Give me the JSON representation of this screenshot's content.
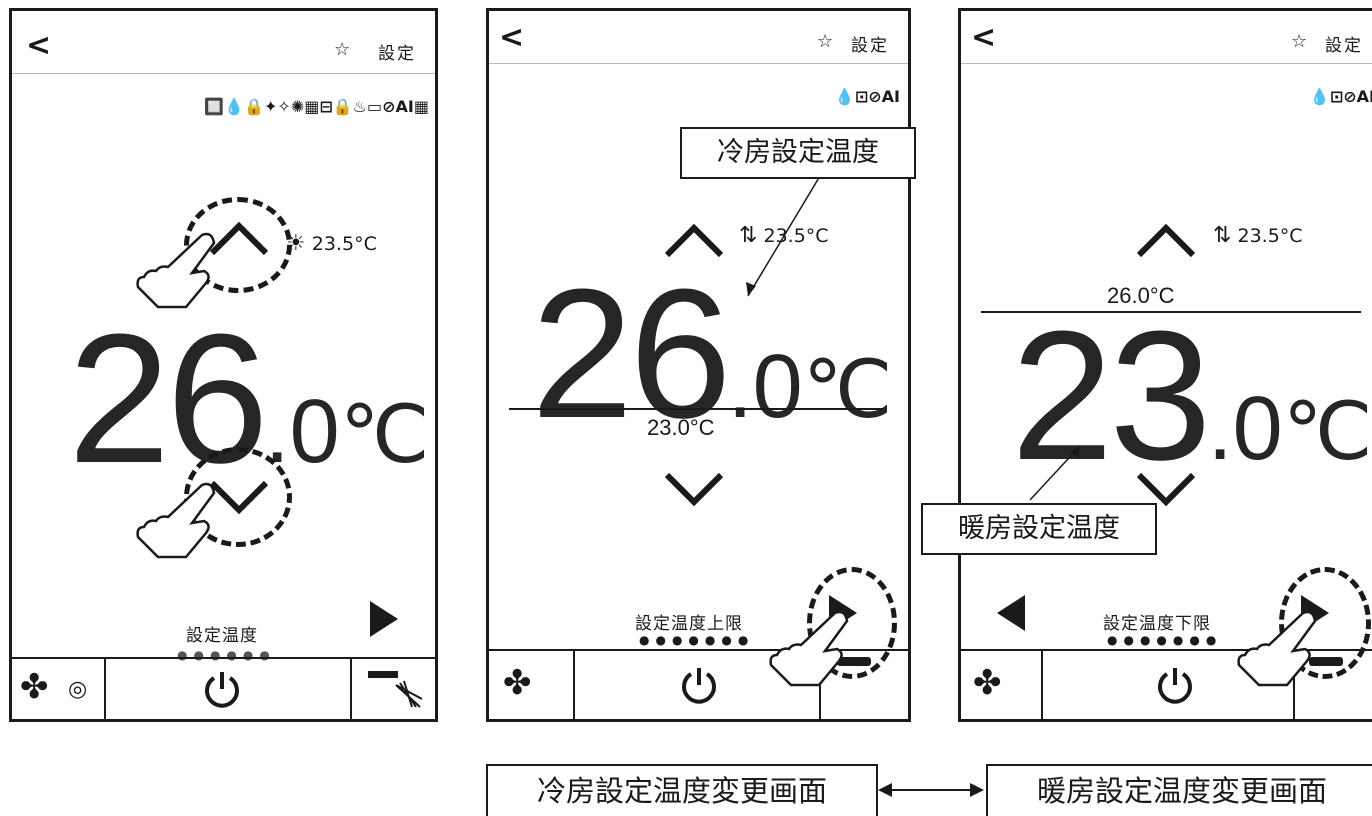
{
  "screens": [
    {
      "back_glyph": "<",
      "star_glyph": "☆",
      "settings_label": "設定",
      "status_icons": "🔲💧🔒✦✧✺▦⊟🔒♨▭⊘AI▦",
      "temp_integer": "26",
      "temp_decimal": ".0",
      "temp_unit": "℃",
      "ambient_icon": "sun-icon",
      "ambient_temp": "23.5°C",
      "page_label": "設定温度",
      "page_dots": "●●●●●●",
      "page_index": 1
    },
    {
      "back_glyph": "<",
      "star_glyph": "☆",
      "settings_label": "設定",
      "status_icons": "AI",
      "temp_integer": "26",
      "temp_decimal": ".0",
      "temp_unit": "℃",
      "ambient_icon": "swap-arrows-icon",
      "ambient_temp": "23.5°C",
      "secondary_temp": "23.0°C",
      "page_label": "設定温度上限",
      "page_dots": "●●●●●●●",
      "page_index": 1
    },
    {
      "back_glyph": "<",
      "star_glyph": "☆",
      "settings_label": "設定",
      "status_icons": "AI",
      "temp_integer": "23",
      "temp_decimal": ".0",
      "temp_unit": "℃",
      "ambient_icon": "swap-arrows-icon",
      "ambient_temp": "23.5°C",
      "secondary_temp": "26.0°C",
      "page_label": "設定温度下限",
      "page_dots": "●●●●●●●",
      "page_index": 2
    }
  ],
  "callouts": {
    "cooling_setpoint": "冷房設定温度",
    "heating_setpoint": "暖房設定温度"
  },
  "captions": {
    "cooling_screen": "冷房設定温度変更画面",
    "heating_screen": "暖房設定温度変更画面"
  }
}
